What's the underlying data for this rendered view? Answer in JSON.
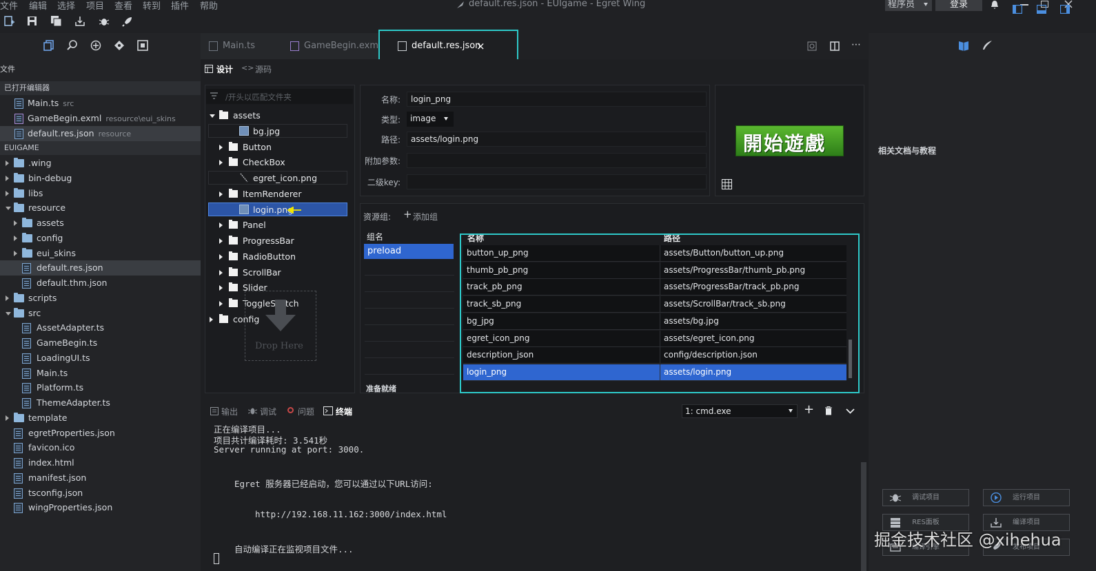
{
  "menu": [
    "文件",
    "编辑",
    "选择",
    "项目",
    "查看",
    "转到",
    "插件",
    "帮助"
  ],
  "window_title": "default.res.json - EUIgame - Egret Wing",
  "user": {
    "role": "程序员",
    "login": "登录"
  },
  "sidebar": {
    "files_label": "文件",
    "open_editors_label": "已打开编辑器",
    "open_editors": [
      {
        "name": "Main.ts",
        "hint": "src"
      },
      {
        "name": "GameBegin.exml",
        "hint": "resource\\eui_skins"
      },
      {
        "name": "default.res.json",
        "hint": "resource"
      }
    ],
    "project_label": "EUIGAME",
    "tree": [
      {
        "name": ".wing",
        "type": "folder"
      },
      {
        "name": "bin-debug",
        "type": "folder"
      },
      {
        "name": "libs",
        "type": "folder"
      },
      {
        "name": "resource",
        "type": "folder"
      },
      {
        "name": "assets",
        "type": "folder"
      },
      {
        "name": "config",
        "type": "folder"
      },
      {
        "name": "eui_skins",
        "type": "folder"
      },
      {
        "name": "default.res.json",
        "type": "file"
      },
      {
        "name": "default.thm.json",
        "type": "file"
      },
      {
        "name": "scripts",
        "type": "folder"
      },
      {
        "name": "src",
        "type": "folder"
      },
      {
        "name": "AssetAdapter.ts",
        "type": "file"
      },
      {
        "name": "GameBegin.ts",
        "type": "file"
      },
      {
        "name": "LoadingUI.ts",
        "type": "file"
      },
      {
        "name": "Main.ts",
        "type": "file"
      },
      {
        "name": "Platform.ts",
        "type": "file"
      },
      {
        "name": "ThemeAdapter.ts",
        "type": "file"
      },
      {
        "name": "template",
        "type": "folder"
      },
      {
        "name": "egretProperties.json",
        "type": "file"
      },
      {
        "name": "favicon.ico",
        "type": "file"
      },
      {
        "name": "index.html",
        "type": "file"
      },
      {
        "name": "manifest.json",
        "type": "file"
      },
      {
        "name": "tsconfig.json",
        "type": "file"
      },
      {
        "name": "wingProperties.json",
        "type": "file"
      }
    ]
  },
  "tabs": [
    {
      "label": "Main.ts"
    },
    {
      "label": "GameBegin.exml"
    },
    {
      "label": "default.res.json",
      "close": "×"
    }
  ],
  "designer": {
    "design_label": "设计",
    "source_label": "源码",
    "filter_placeholder": "/开头以匹配文件夹",
    "file_tree": [
      {
        "name": "assets"
      },
      {
        "name": "bg.jpg"
      },
      {
        "name": "Button"
      },
      {
        "name": "CheckBox"
      },
      {
        "name": "egret_icon.png"
      },
      {
        "name": "ItemRenderer"
      },
      {
        "name": "login.png"
      },
      {
        "name": "Panel"
      },
      {
        "name": "ProgressBar"
      },
      {
        "name": "RadioButton"
      },
      {
        "name": "ScrollBar"
      },
      {
        "name": "Slider"
      },
      {
        "name": "ToggleSwitch"
      },
      {
        "name": "config"
      }
    ],
    "drop_here": "Drop Here",
    "props": {
      "name_label": "名称:",
      "name_value": "login_png",
      "type_label": "类型:",
      "type_value": "image",
      "path_label": "路径:",
      "path_value": "assets/login.png",
      "extra_label": "附加参数:",
      "extra_value": "",
      "subkey_label": "二级key:",
      "subkey_value": ""
    },
    "preview_text": "開始遊戲",
    "resgroup": {
      "label": "资源组:",
      "add_label": "添加组",
      "group_col": "组名",
      "groups": [
        "preload"
      ],
      "status": "准备就绪",
      "name_col": "名称",
      "path_col": "路径",
      "rows": [
        {
          "name": "button_up_png",
          "path": "assets/Button/button_up.png"
        },
        {
          "name": "thumb_pb_png",
          "path": "assets/ProgressBar/thumb_pb.png"
        },
        {
          "name": "track_pb_png",
          "path": "assets/ProgressBar/track_pb.png"
        },
        {
          "name": "track_sb_png",
          "path": "assets/ScrollBar/track_sb.png"
        },
        {
          "name": "bg_jpg",
          "path": "assets/bg.jpg"
        },
        {
          "name": "egret_icon_png",
          "path": "assets/egret_icon.png"
        },
        {
          "name": "description_json",
          "path": "config/description.json"
        },
        {
          "name": "login_png",
          "path": "assets/login.png"
        }
      ]
    }
  },
  "panel": {
    "tabs": [
      "输出",
      "调试",
      "问题",
      "终端"
    ],
    "terminal_select": "1: cmd.exe",
    "lines": [
      "正在编译项目...",
      "项目共计编译耗时: 3.541秒",
      "Server running at port: 3000.",
      "Egret 服务器已经启动，您可以通过以下URL访问:",
      "http://192.168.11.162:3000/index.html",
      "自动编译正在监视项目文件..."
    ]
  },
  "right": {
    "docs_label": "相关文档与教程",
    "buttons": [
      "调试项目",
      "运行项目",
      "RES面板",
      "编译项目",
      "编译引擎",
      "发布项目"
    ]
  },
  "watermark": "掘金技术社区 @xihehua",
  "colors": {
    "accent_cyan": "#2ec9c9",
    "selection_blue": "#2f66d0",
    "preview_green": "#3a8e1f"
  }
}
